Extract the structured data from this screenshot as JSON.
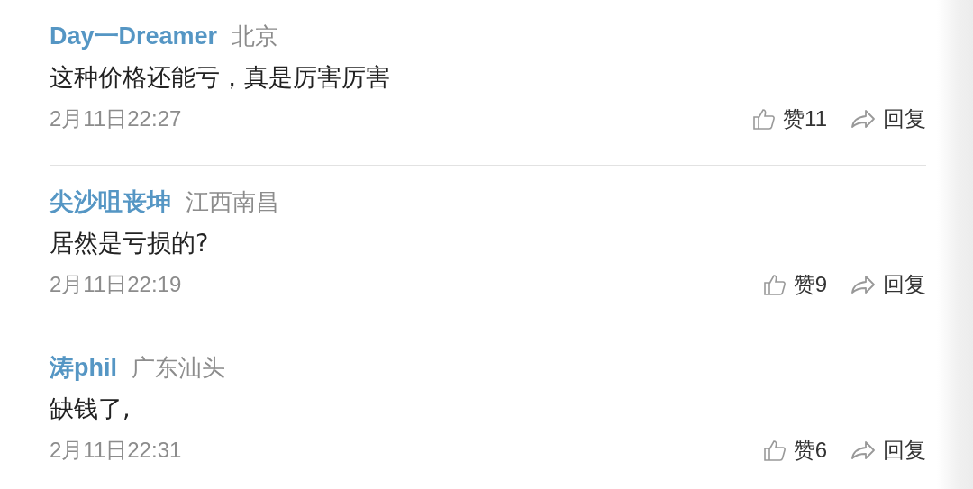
{
  "comments": [
    {
      "user": "Day一Dreamer",
      "location": "北京",
      "text": "这种价格还能亏，真是厉害厉害",
      "time": "2月11日22:27",
      "likes": "赞11",
      "reply": "回复"
    },
    {
      "user": "尖沙咀丧坤",
      "location": "江西南昌",
      "text": "居然是亏损的?",
      "time": "2月11日22:19",
      "likes": "赞9",
      "reply": "回复"
    },
    {
      "user": "涛phil",
      "location": "广东汕头",
      "text": "缺钱了,",
      "time": "2月11日22:31",
      "likes": "赞6",
      "reply": "回复"
    }
  ]
}
